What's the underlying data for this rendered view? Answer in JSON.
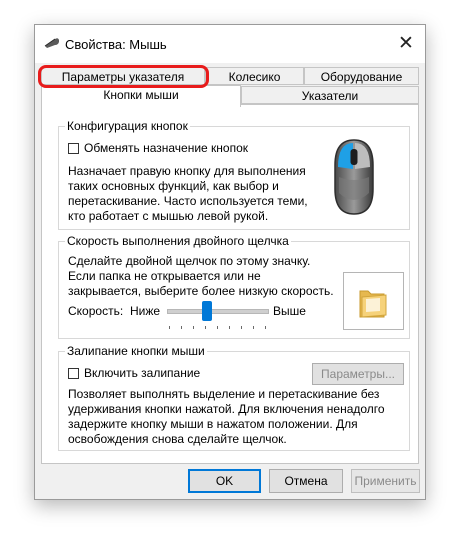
{
  "window": {
    "title": "Свойства: Мышь",
    "close_glyph": "✕"
  },
  "tabs": {
    "row_back": [
      {
        "label": "Параметры указателя"
      },
      {
        "label": "Колесико"
      },
      {
        "label": "Оборудование"
      }
    ],
    "row_front": [
      {
        "label": "Кнопки мыши",
        "active": true
      },
      {
        "label": "Указатели"
      }
    ]
  },
  "button_config": {
    "title": "Конфигурация кнопок",
    "swap_checkbox_label": "Обменять назначение кнопок",
    "swap_checked": false,
    "description": [
      "Назначает правую кнопку для выполнения",
      "таких основных функций, как выбор и",
      "перетаскивание. Часто используется теми,",
      "кто работает с мышью левой рукой."
    ],
    "mouse_icon": "mouse-icon"
  },
  "double_click": {
    "title": "Скорость выполнения двойного щелчка",
    "description": [
      "Сделайте двойной щелчок по этому значку.",
      "Если папка не открывается или не",
      "закрывается, выберите более низкую скорость."
    ],
    "speed_label": "Скорость:",
    "slow_label": "Ниже",
    "fast_label": "Выше",
    "speed_fraction": 0.4,
    "folder_icon": "folder-icon"
  },
  "click_lock": {
    "title": "Залипание кнопки мыши",
    "checkbox_label": "Включить залипание",
    "checked": false,
    "settings_button": "Параметры...",
    "description": [
      "Позволяет выполнять выделение и перетаскивание без",
      "удерживания кнопки нажатой. Для включения ненадолго",
      "задержите кнопку мыши в нажатом положении. Для",
      "освобождения снова сделайте щелчок."
    ]
  },
  "footer": {
    "ok": "OK",
    "cancel": "Отмена",
    "apply": "Применить"
  },
  "colors": {
    "accent": "#0078d7",
    "highlight": "#e81c1c"
  }
}
